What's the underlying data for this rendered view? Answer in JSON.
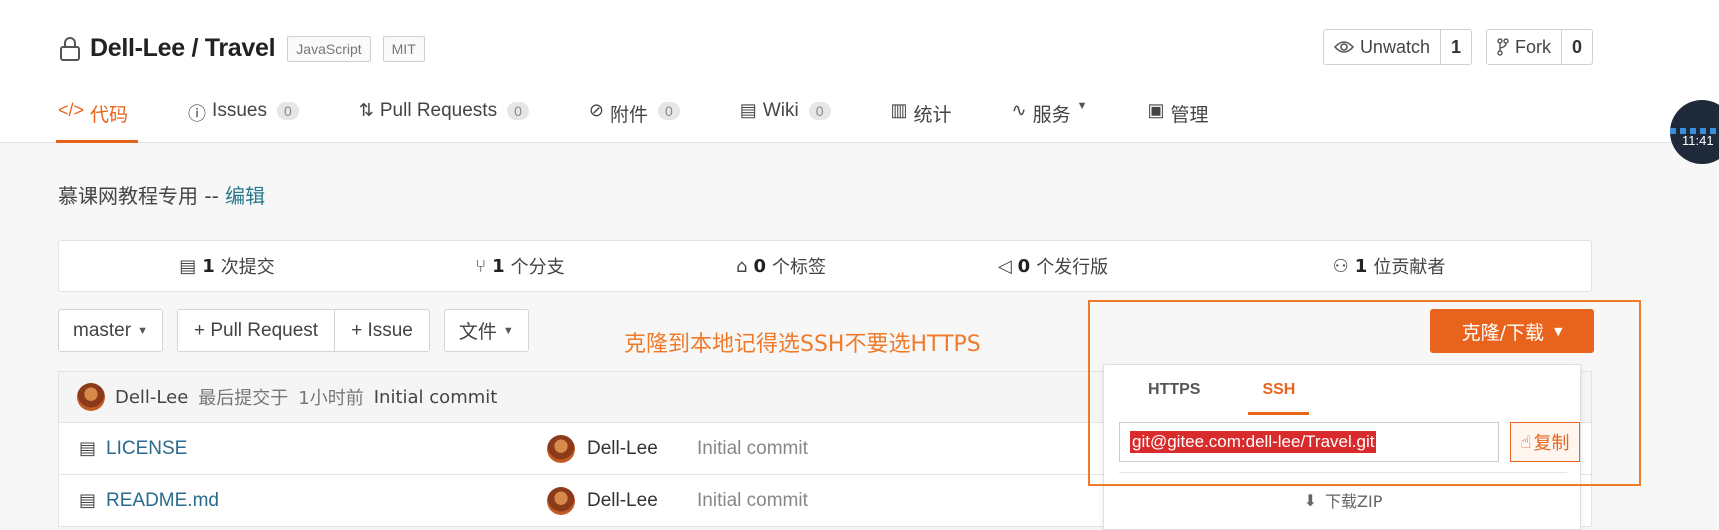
{
  "repo": {
    "title": "Dell-Lee / Travel",
    "tags": [
      "JavaScript",
      "MIT"
    ]
  },
  "actions": {
    "watch_label": "Unwatch",
    "watch_count": "1",
    "fork_label": "Fork",
    "fork_count": "0"
  },
  "tabs": [
    {
      "label": "代码",
      "icon": "code-icon",
      "active": true
    },
    {
      "label": "Issues",
      "icon": "issue-icon",
      "badge": "0"
    },
    {
      "label": "Pull Requests",
      "icon": "pull-request-icon",
      "badge": "0"
    },
    {
      "label": "附件",
      "icon": "attachment-icon",
      "badge": "0"
    },
    {
      "label": "Wiki",
      "icon": "wiki-icon",
      "badge": "0"
    },
    {
      "label": "统计",
      "icon": "stats-icon"
    },
    {
      "label": "服务",
      "icon": "service-icon",
      "dropdown": true
    },
    {
      "label": "管理",
      "icon": "manage-icon"
    }
  ],
  "description": {
    "text": "慕课网教程专用 -- ",
    "edit": "编辑"
  },
  "stats": [
    {
      "count": "1",
      "label": "次提交",
      "icon": "commit-icon"
    },
    {
      "count": "1",
      "label": "个分支",
      "icon": "branch-icon"
    },
    {
      "count": "0",
      "label": "个标签",
      "icon": "tag-icon"
    },
    {
      "count": "0",
      "label": "个发行版",
      "icon": "release-icon"
    },
    {
      "count": "1",
      "label": "位贡献者",
      "icon": "contributors-icon"
    }
  ],
  "toolbar": {
    "branch": "master",
    "pull_request": "+ Pull Request",
    "issue": "+ Issue",
    "file": "文件",
    "clone": "克隆/下载"
  },
  "annotation": "克隆到本地记得选SSH不要选HTTPS",
  "last_commit": {
    "author": "Dell-Lee",
    "prefix": "最后提交于",
    "time": "1小时前",
    "message": "Initial commit"
  },
  "files": [
    {
      "name": "LICENSE",
      "author": "Dell-Lee",
      "message": "Initial commit"
    },
    {
      "name": "README.md",
      "author": "Dell-Lee",
      "message": "Initial commit"
    }
  ],
  "clone_dropdown": {
    "tab_https": "HTTPS",
    "tab_ssh": "SSH",
    "active_tab": "SSH",
    "url": "git@gitee.com:dell-lee/Travel.git",
    "copy": "复制",
    "zip": "下载ZIP"
  },
  "clock": "11:41",
  "colors": {
    "accent": "#e8641c",
    "annotation": "#f07a2a",
    "url_highlight": "#d92b2b"
  }
}
